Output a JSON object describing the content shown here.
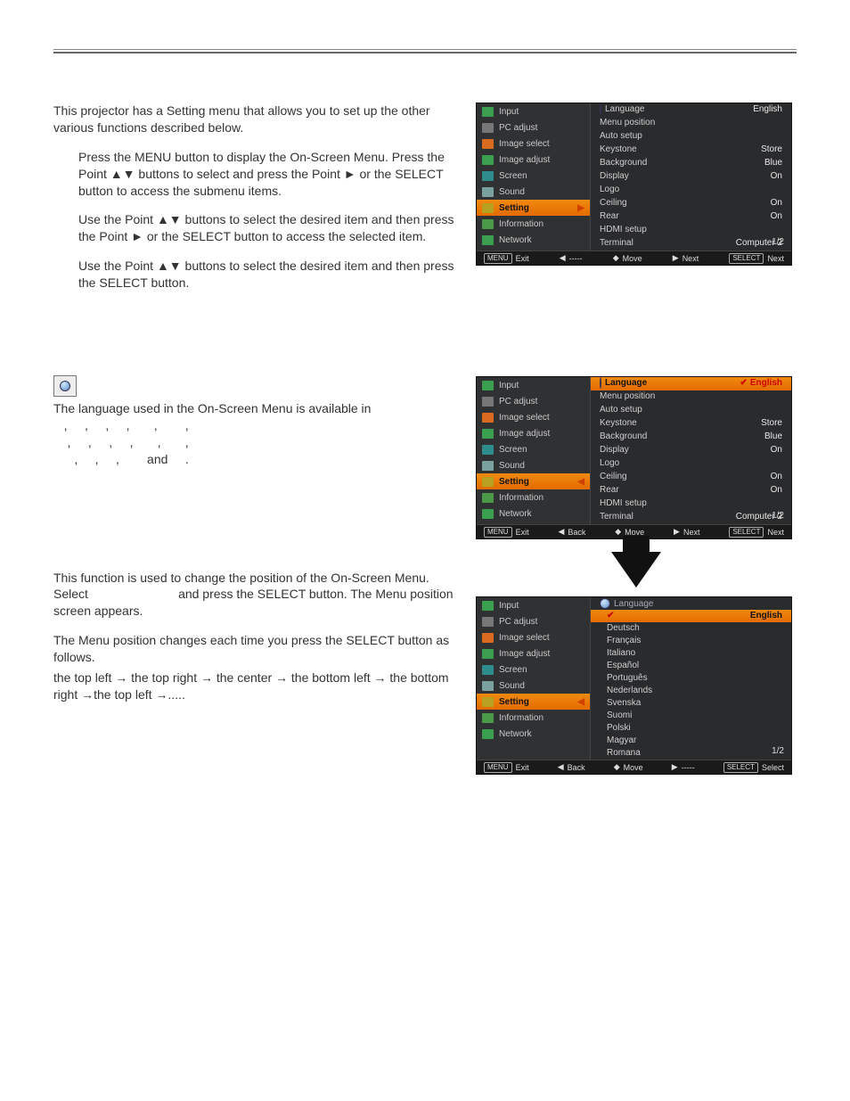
{
  "intro": "This projector has a Setting menu that allows you to set up the other various functions described below.",
  "steps": {
    "s1": "Press the MENU button to display the On-Screen Menu.  Press the Point ▲▼ buttons to select and press the Point ► or the SELECT button to access the submenu items.",
    "s2": "Use the Point ▲▼ buttons to select the desired item and then press the Point ► or the SELECT button to access the selected item.",
    "s3": "Use the Point ▲▼ buttons to select the desired item and then press the SELECT button."
  },
  "lang_para": "The language used in the On-Screen Menu is available in",
  "lang_end": "and",
  "menupos": {
    "p1a": "This function is used to change the position of the On-Screen Menu. Select",
    "p1b": "and press the SELECT button. The Menu position screen appears.",
    "p2": "The Menu position changes each time you press the SELECT button as follows.",
    "seq": "the top left  → the top right  → the center → the bottom left → the bottom right  →the top left  →....."
  },
  "osd": {
    "left_items": [
      "Input",
      "PC adjust",
      "Image select",
      "Image adjust",
      "Screen",
      "Sound",
      "Setting",
      "Information",
      "Network"
    ],
    "right_items": [
      {
        "k": "Language",
        "v": "English"
      },
      {
        "k": "Menu position",
        "v": ""
      },
      {
        "k": "Auto setup",
        "v": ""
      },
      {
        "k": "Keystone",
        "v": "Store"
      },
      {
        "k": "Background",
        "v": "Blue"
      },
      {
        "k": "Display",
        "v": "On"
      },
      {
        "k": "Logo",
        "v": ""
      },
      {
        "k": "Ceiling",
        "v": "On"
      },
      {
        "k": "Rear",
        "v": "On"
      },
      {
        "k": "HDMI setup",
        "v": ""
      },
      {
        "k": "Terminal",
        "v": "Computer 2"
      }
    ],
    "page": "1/2",
    "foot": {
      "exit": "Exit",
      "back": "Back",
      "move": "Move",
      "next": "Next",
      "sel": "Next",
      "sel2": "Select",
      "menu": "MENU",
      "select": "SELECT",
      "dashes": "-----"
    }
  },
  "langlist": [
    "English",
    "Deutsch",
    "Français",
    "Italiano",
    "Español",
    "Português",
    "Nederlands",
    "Svenska",
    "Suomi",
    "Polski",
    "Magyar",
    "Romana"
  ]
}
